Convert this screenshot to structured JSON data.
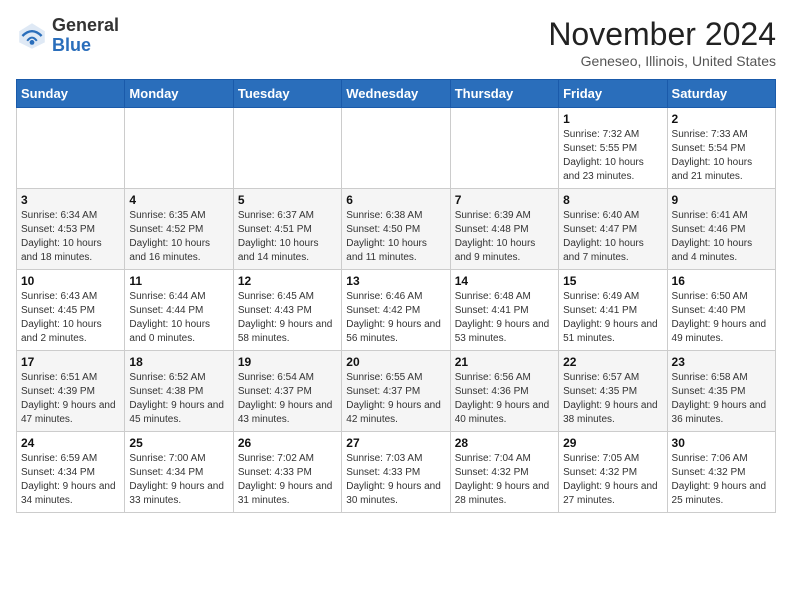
{
  "header": {
    "logo_line1": "General",
    "logo_line2": "Blue",
    "month_title": "November 2024",
    "location": "Geneseo, Illinois, United States"
  },
  "weekdays": [
    "Sunday",
    "Monday",
    "Tuesday",
    "Wednesday",
    "Thursday",
    "Friday",
    "Saturday"
  ],
  "weeks": [
    [
      {
        "day": "",
        "info": ""
      },
      {
        "day": "",
        "info": ""
      },
      {
        "day": "",
        "info": ""
      },
      {
        "day": "",
        "info": ""
      },
      {
        "day": "",
        "info": ""
      },
      {
        "day": "1",
        "info": "Sunrise: 7:32 AM\nSunset: 5:55 PM\nDaylight: 10 hours and 23 minutes."
      },
      {
        "day": "2",
        "info": "Sunrise: 7:33 AM\nSunset: 5:54 PM\nDaylight: 10 hours and 21 minutes."
      }
    ],
    [
      {
        "day": "3",
        "info": "Sunrise: 6:34 AM\nSunset: 4:53 PM\nDaylight: 10 hours and 18 minutes."
      },
      {
        "day": "4",
        "info": "Sunrise: 6:35 AM\nSunset: 4:52 PM\nDaylight: 10 hours and 16 minutes."
      },
      {
        "day": "5",
        "info": "Sunrise: 6:37 AM\nSunset: 4:51 PM\nDaylight: 10 hours and 14 minutes."
      },
      {
        "day": "6",
        "info": "Sunrise: 6:38 AM\nSunset: 4:50 PM\nDaylight: 10 hours and 11 minutes."
      },
      {
        "day": "7",
        "info": "Sunrise: 6:39 AM\nSunset: 4:48 PM\nDaylight: 10 hours and 9 minutes."
      },
      {
        "day": "8",
        "info": "Sunrise: 6:40 AM\nSunset: 4:47 PM\nDaylight: 10 hours and 7 minutes."
      },
      {
        "day": "9",
        "info": "Sunrise: 6:41 AM\nSunset: 4:46 PM\nDaylight: 10 hours and 4 minutes."
      }
    ],
    [
      {
        "day": "10",
        "info": "Sunrise: 6:43 AM\nSunset: 4:45 PM\nDaylight: 10 hours and 2 minutes."
      },
      {
        "day": "11",
        "info": "Sunrise: 6:44 AM\nSunset: 4:44 PM\nDaylight: 10 hours and 0 minutes."
      },
      {
        "day": "12",
        "info": "Sunrise: 6:45 AM\nSunset: 4:43 PM\nDaylight: 9 hours and 58 minutes."
      },
      {
        "day": "13",
        "info": "Sunrise: 6:46 AM\nSunset: 4:42 PM\nDaylight: 9 hours and 56 minutes."
      },
      {
        "day": "14",
        "info": "Sunrise: 6:48 AM\nSunset: 4:41 PM\nDaylight: 9 hours and 53 minutes."
      },
      {
        "day": "15",
        "info": "Sunrise: 6:49 AM\nSunset: 4:41 PM\nDaylight: 9 hours and 51 minutes."
      },
      {
        "day": "16",
        "info": "Sunrise: 6:50 AM\nSunset: 4:40 PM\nDaylight: 9 hours and 49 minutes."
      }
    ],
    [
      {
        "day": "17",
        "info": "Sunrise: 6:51 AM\nSunset: 4:39 PM\nDaylight: 9 hours and 47 minutes."
      },
      {
        "day": "18",
        "info": "Sunrise: 6:52 AM\nSunset: 4:38 PM\nDaylight: 9 hours and 45 minutes."
      },
      {
        "day": "19",
        "info": "Sunrise: 6:54 AM\nSunset: 4:37 PM\nDaylight: 9 hours and 43 minutes."
      },
      {
        "day": "20",
        "info": "Sunrise: 6:55 AM\nSunset: 4:37 PM\nDaylight: 9 hours and 42 minutes."
      },
      {
        "day": "21",
        "info": "Sunrise: 6:56 AM\nSunset: 4:36 PM\nDaylight: 9 hours and 40 minutes."
      },
      {
        "day": "22",
        "info": "Sunrise: 6:57 AM\nSunset: 4:35 PM\nDaylight: 9 hours and 38 minutes."
      },
      {
        "day": "23",
        "info": "Sunrise: 6:58 AM\nSunset: 4:35 PM\nDaylight: 9 hours and 36 minutes."
      }
    ],
    [
      {
        "day": "24",
        "info": "Sunrise: 6:59 AM\nSunset: 4:34 PM\nDaylight: 9 hours and 34 minutes."
      },
      {
        "day": "25",
        "info": "Sunrise: 7:00 AM\nSunset: 4:34 PM\nDaylight: 9 hours and 33 minutes."
      },
      {
        "day": "26",
        "info": "Sunrise: 7:02 AM\nSunset: 4:33 PM\nDaylight: 9 hours and 31 minutes."
      },
      {
        "day": "27",
        "info": "Sunrise: 7:03 AM\nSunset: 4:33 PM\nDaylight: 9 hours and 30 minutes."
      },
      {
        "day": "28",
        "info": "Sunrise: 7:04 AM\nSunset: 4:32 PM\nDaylight: 9 hours and 28 minutes."
      },
      {
        "day": "29",
        "info": "Sunrise: 7:05 AM\nSunset: 4:32 PM\nDaylight: 9 hours and 27 minutes."
      },
      {
        "day": "30",
        "info": "Sunrise: 7:06 AM\nSunset: 4:32 PM\nDaylight: 9 hours and 25 minutes."
      }
    ]
  ]
}
